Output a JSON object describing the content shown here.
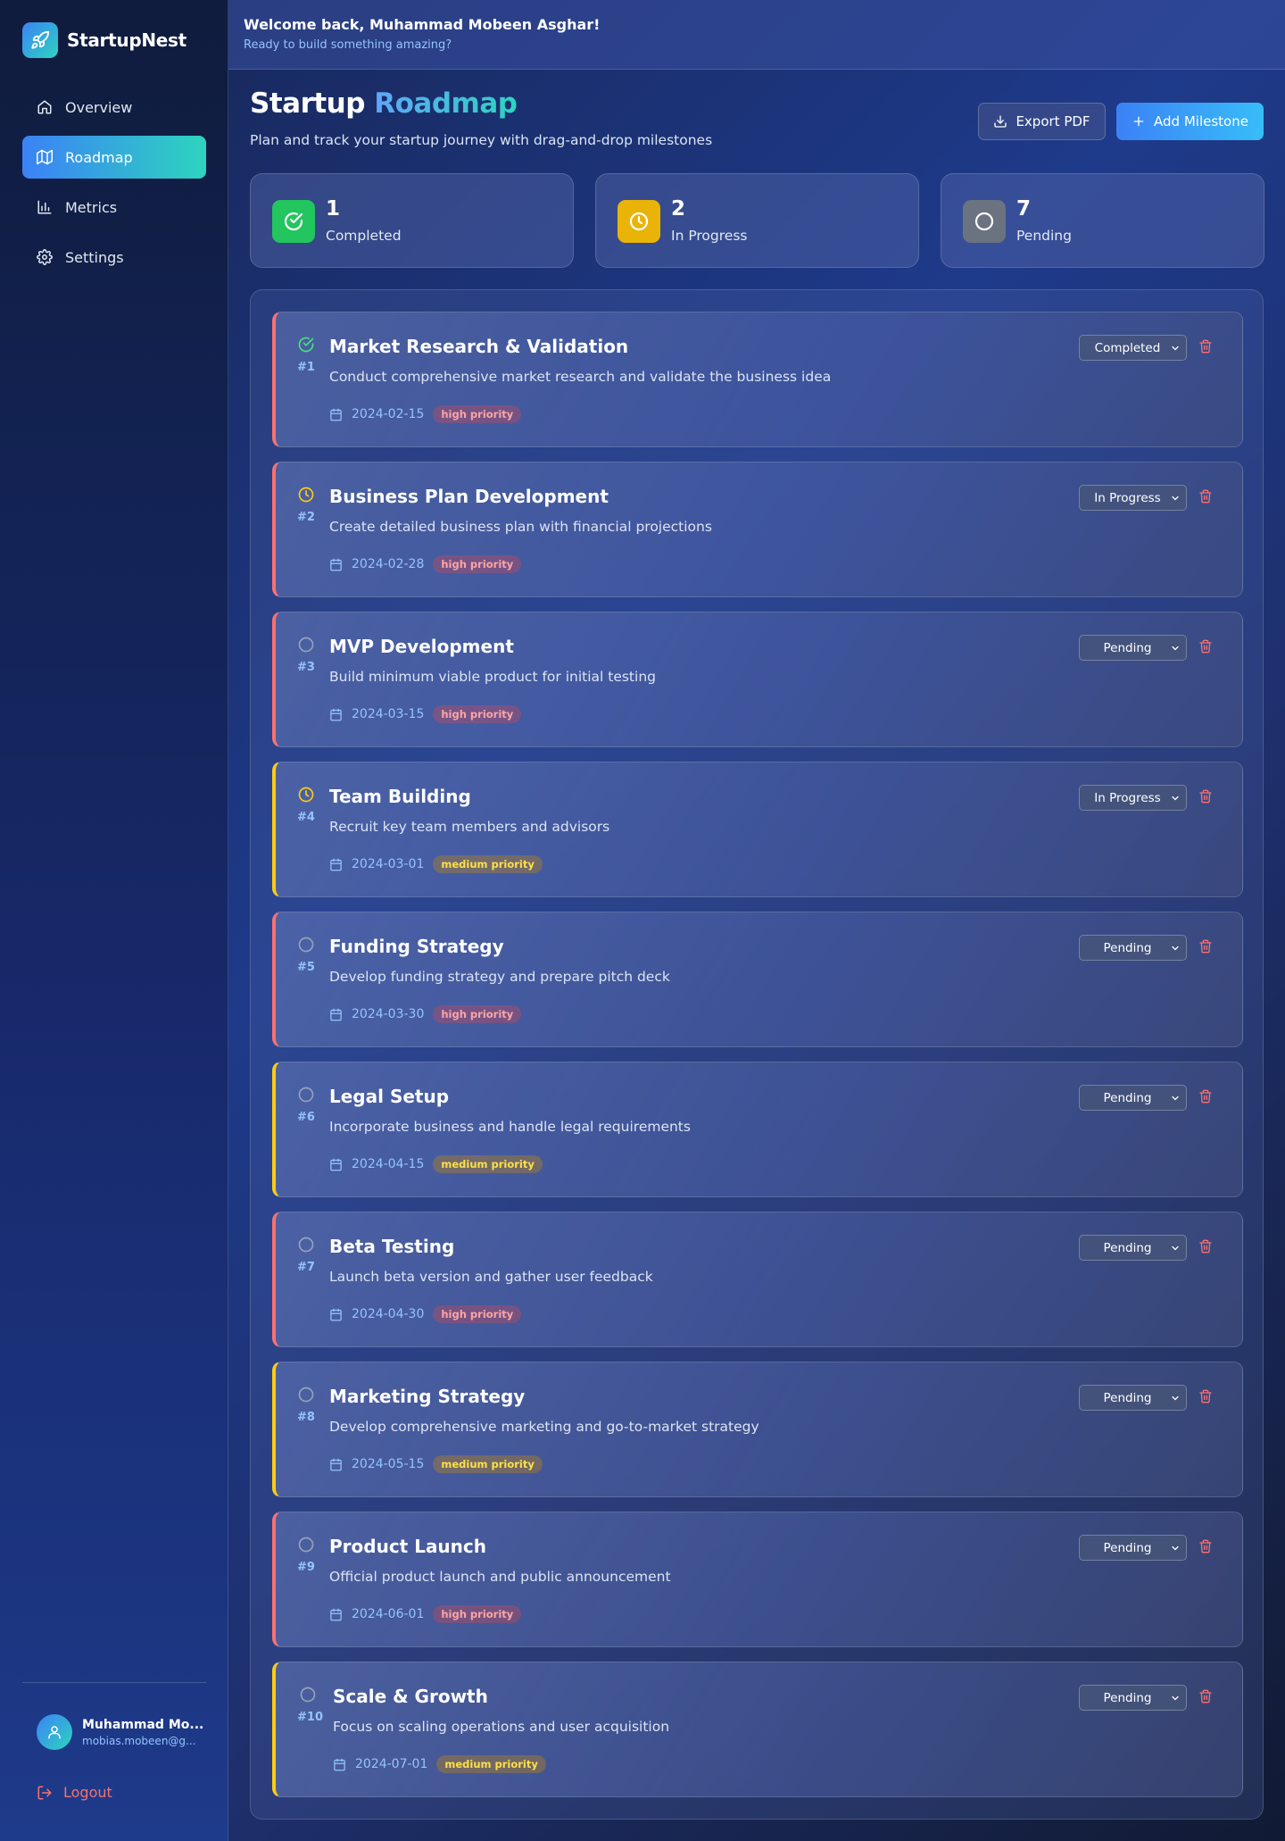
{
  "brand": {
    "name": "StartupNest"
  },
  "nav": [
    {
      "label": "Overview",
      "icon": "home-icon",
      "active": false
    },
    {
      "label": "Roadmap",
      "icon": "map-icon",
      "active": true
    },
    {
      "label": "Metrics",
      "icon": "bar-chart-icon",
      "active": false
    },
    {
      "label": "Settings",
      "icon": "gear-icon",
      "active": false
    }
  ],
  "user": {
    "name": "Muhammad Mo...",
    "email": "mobias.mobeen@g..."
  },
  "logout_label": "Logout",
  "topbar": {
    "welcome": "Welcome back, Muhammad Mobeen Asghar!",
    "subtitle": "Ready to build something amazing?"
  },
  "header": {
    "title_part1": "Startup",
    "title_part2": "Roadmap",
    "subtitle": "Plan and track your startup journey with drag-and-drop milestones",
    "export_label": "Export PDF",
    "add_label": "Add Milestone"
  },
  "stats": [
    {
      "value": "1",
      "label": "Completed",
      "color": "#22c55e",
      "icon": "check-circle-icon"
    },
    {
      "value": "2",
      "label": "In Progress",
      "color": "#eab308",
      "icon": "clock-icon"
    },
    {
      "value": "7",
      "label": "Pending",
      "color": "#6b7280",
      "icon": "circle-icon"
    }
  ],
  "colors": {
    "high": "#f87171",
    "medium": "#facc15",
    "completed": "#4ade80",
    "in_progress": "#facc15",
    "pending": "#94a3b8",
    "accent": "#3b82f6"
  },
  "milestones": [
    {
      "index": "#1",
      "title": "Market Research & Validation",
      "description": "Conduct comprehensive market research and validate the business idea",
      "date": "2024-02-15",
      "priority": "high",
      "priority_label": "high priority",
      "status": "Completed"
    },
    {
      "index": "#2",
      "title": "Business Plan Development",
      "description": "Create detailed business plan with financial projections",
      "date": "2024-02-28",
      "priority": "high",
      "priority_label": "high priority",
      "status": "In Progress"
    },
    {
      "index": "#3",
      "title": "MVP Development",
      "description": "Build minimum viable product for initial testing",
      "date": "2024-03-15",
      "priority": "high",
      "priority_label": "high priority",
      "status": "Pending"
    },
    {
      "index": "#4",
      "title": "Team Building",
      "description": "Recruit key team members and advisors",
      "date": "2024-03-01",
      "priority": "medium",
      "priority_label": "medium priority",
      "status": "In Progress"
    },
    {
      "index": "#5",
      "title": "Funding Strategy",
      "description": "Develop funding strategy and prepare pitch deck",
      "date": "2024-03-30",
      "priority": "high",
      "priority_label": "high priority",
      "status": "Pending"
    },
    {
      "index": "#6",
      "title": "Legal Setup",
      "description": "Incorporate business and handle legal requirements",
      "date": "2024-04-15",
      "priority": "medium",
      "priority_label": "medium priority",
      "status": "Pending"
    },
    {
      "index": "#7",
      "title": "Beta Testing",
      "description": "Launch beta version and gather user feedback",
      "date": "2024-04-30",
      "priority": "high",
      "priority_label": "high priority",
      "status": "Pending"
    },
    {
      "index": "#8",
      "title": "Marketing Strategy",
      "description": "Develop comprehensive marketing and go-to-market strategy",
      "date": "2024-05-15",
      "priority": "medium",
      "priority_label": "medium priority",
      "status": "Pending"
    },
    {
      "index": "#9",
      "title": "Product Launch",
      "description": "Official product launch and public announcement",
      "date": "2024-06-01",
      "priority": "high",
      "priority_label": "high priority",
      "status": "Pending"
    },
    {
      "index": "#10",
      "title": "Scale & Growth",
      "description": "Focus on scaling operations and user acquisition",
      "date": "2024-07-01",
      "priority": "medium",
      "priority_label": "medium priority",
      "status": "Pending"
    }
  ]
}
